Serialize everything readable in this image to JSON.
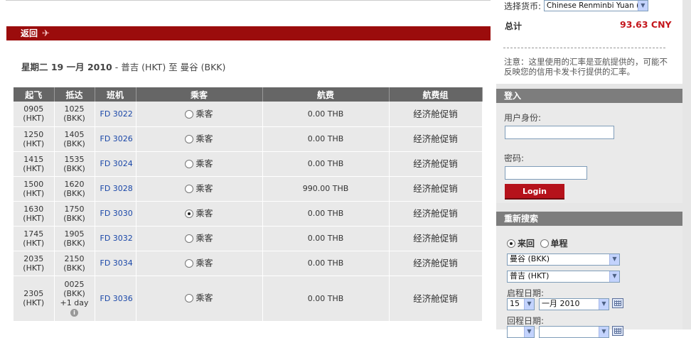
{
  "back": {
    "label": "返回"
  },
  "journey": {
    "date": "星期二 19 一月 2010",
    "route": " - 普吉 (HKT) 至 曼谷 (BKK)"
  },
  "table": {
    "headers": [
      "起飞",
      "抵达",
      "班机",
      "乘客",
      "航费",
      "航费组"
    ],
    "rows": [
      {
        "dep_time": "0905",
        "dep_code": "(HKT)",
        "arr_time": "1025",
        "arr_code": "(BKK)",
        "flight": "FD 3022",
        "pax": "乘客",
        "fare": "0.00 THB",
        "group": "经济舱促销",
        "selected": false
      },
      {
        "dep_time": "1250",
        "dep_code": "(HKT)",
        "arr_time": "1405",
        "arr_code": "(BKK)",
        "flight": "FD 3026",
        "pax": "乘客",
        "fare": "0.00 THB",
        "group": "经济舱促销",
        "selected": false
      },
      {
        "dep_time": "1415",
        "dep_code": "(HKT)",
        "arr_time": "1535",
        "arr_code": "(BKK)",
        "flight": "FD 3024",
        "pax": "乘客",
        "fare": "0.00 THB",
        "group": "经济舱促销",
        "selected": false
      },
      {
        "dep_time": "1500",
        "dep_code": "(HKT)",
        "arr_time": "1620",
        "arr_code": "(BKK)",
        "flight": "FD 3028",
        "pax": "乘客",
        "fare": "990.00 THB",
        "group": "经济舱促销",
        "selected": false
      },
      {
        "dep_time": "1630",
        "dep_code": "(HKT)",
        "arr_time": "1750",
        "arr_code": "(BKK)",
        "flight": "FD 3030",
        "pax": "乘客",
        "fare": "0.00 THB",
        "group": "经济舱促销",
        "selected": true
      },
      {
        "dep_time": "1745",
        "dep_code": "(HKT)",
        "arr_time": "1905",
        "arr_code": "(BKK)",
        "flight": "FD 3032",
        "pax": "乘客",
        "fare": "0.00 THB",
        "group": "经济舱促销",
        "selected": false
      },
      {
        "dep_time": "2035",
        "dep_code": "(HKT)",
        "arr_time": "2150",
        "arr_code": "(BKK)",
        "flight": "FD 3034",
        "pax": "乘客",
        "fare": "0.00 THB",
        "group": "经济舱促销",
        "selected": false
      },
      {
        "dep_time": "2305",
        "dep_code": "(HKT)",
        "arr_time": "0025",
        "arr_code": "(BKK)",
        "arr_extra": "+1 day",
        "flight": "FD 3036",
        "pax": "乘客",
        "fare": "0.00 THB",
        "group": "经济舱促销",
        "selected": false
      }
    ]
  },
  "sidebar": {
    "currency_label": "选择货币:",
    "currency_value": "Chinese Renminbi Yuan (C",
    "total_label": "总计",
    "total_value": "93.63 CNY",
    "note": "注意：这里使用的汇率是亚航提供的，可能不反映您的信用卡发卡行提供的汇率。",
    "login": {
      "title": "登入",
      "user_label": "用户身份:",
      "password_label": "密码:",
      "button": "Login"
    },
    "search": {
      "title": "重新搜索",
      "roundtrip": "来回",
      "oneway": "单程",
      "from": "曼谷 (BKK)",
      "to": "普吉 (HKT)",
      "depart_label": "启程日期:",
      "depart_day": "15",
      "depart_month": "一月 2010",
      "return_label": "回程日期:"
    }
  }
}
